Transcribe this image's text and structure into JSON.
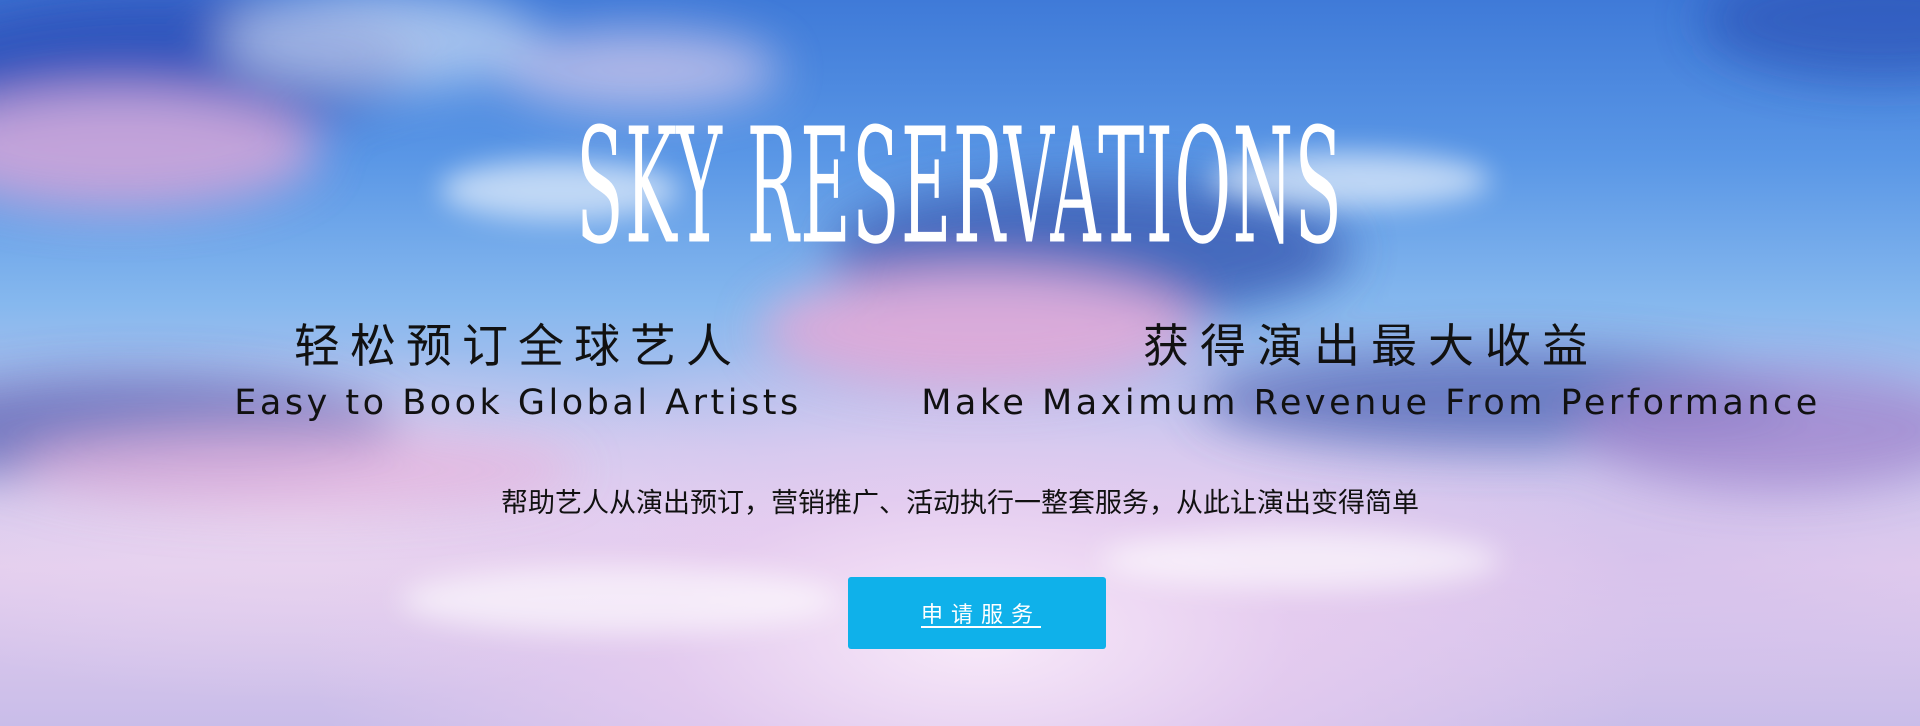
{
  "hero": {
    "title": "SKY RESERVATIONS",
    "left_feature": {
      "cn": "轻松预订全球艺人",
      "en": "Easy to Book Global Artists"
    },
    "right_feature": {
      "cn": "获得演出最大收益",
      "en": "Make Maximum Revenue From Performance"
    },
    "description": "帮助艺人从演出预订，营销推广、活动执行一整套服务，从此让演出变得简单",
    "cta_label": "申请服务"
  },
  "colors": {
    "sky_top": "#3f7ad8",
    "sky_bottom": "#e3cdee",
    "button": "#0fb1ea",
    "title_text": "#ffffff",
    "body_text": "#111111"
  }
}
